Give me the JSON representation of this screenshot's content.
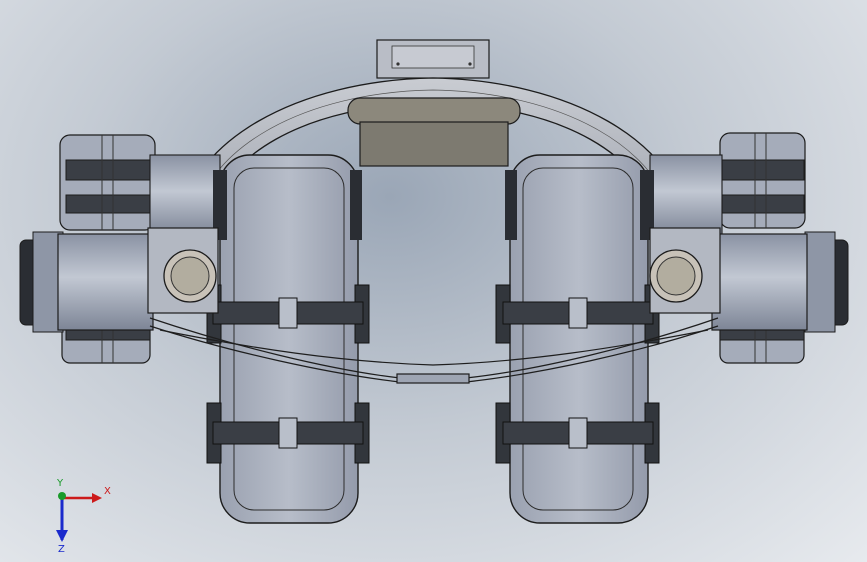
{
  "axes": {
    "x_label": "X",
    "y_label": "Y",
    "z_label": "Z",
    "x_color": "#cc1a1a",
    "y_color": "#1a9a2a",
    "z_color": "#1a2acc"
  },
  "colors": {
    "background_center": "#9aa6b6",
    "background_edge": "#e7eaee",
    "part_fill": "#a9b0be",
    "part_dark": "#2a2d33",
    "tread": "#32363c",
    "bridge": "#7d7a70",
    "outline": "#1c1c1c"
  }
}
